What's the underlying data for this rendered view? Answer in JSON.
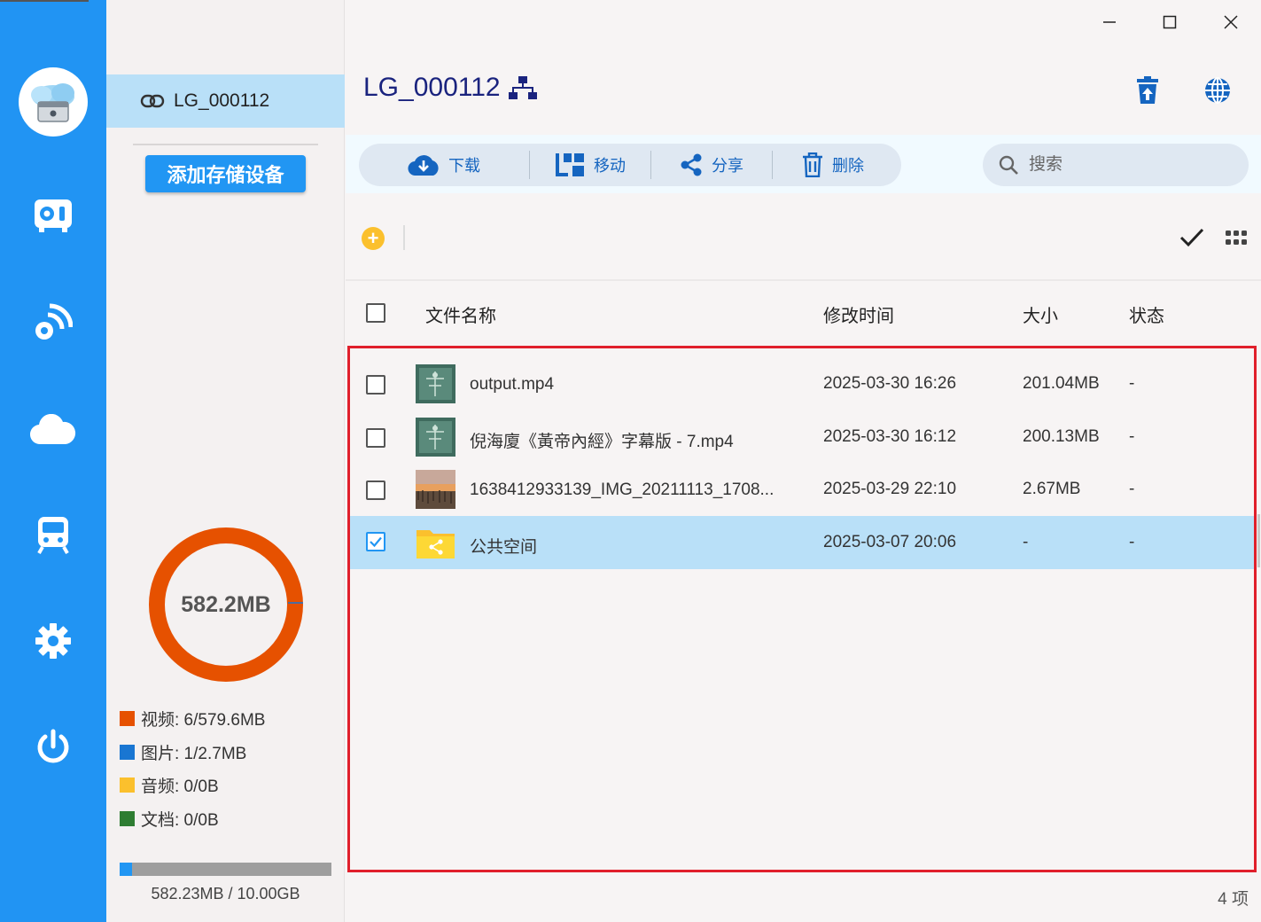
{
  "rail": {
    "icons": [
      "cloud-storage-logo",
      "nas-drive-icon",
      "remote-access-icon",
      "cloud-icon",
      "train-icon",
      "settings-gear-icon",
      "power-icon"
    ]
  },
  "sidebar": {
    "device_label": "LG_000112",
    "add_button": "添加存储设备",
    "donut_label": "582.2MB",
    "legend": [
      {
        "text": "视频: 6/579.6MB",
        "color": "#e65100"
      },
      {
        "text": "图片: 1/2.7MB",
        "color": "#1976d2"
      },
      {
        "text": "音频: 0/0B",
        "color": "#fbc02d"
      },
      {
        "text": "文档: 0/0B",
        "color": "#2e7d32"
      }
    ],
    "usage_fraction": 0.057,
    "usage_text": "582.23MB / 10.00GB"
  },
  "header": {
    "title": "LG_000112",
    "title_icon": "network-icon",
    "actions": [
      "recycle-bin-upload-icon",
      "globe-icon"
    ]
  },
  "toolbar": {
    "download": "下载",
    "move": "移动",
    "share": "分享",
    "delete": "删除"
  },
  "search": {
    "placeholder": "搜索"
  },
  "table": {
    "columns": {
      "name": "文件名称",
      "modified": "修改时间",
      "size": "大小",
      "status": "状态"
    },
    "rows": [
      {
        "name": "output.mp4",
        "modified": "2025-03-30 16:26",
        "size": "201.04MB",
        "status": "-",
        "checked": false,
        "thumb": "video-thumb"
      },
      {
        "name": "倪海廈《黃帝內經》字幕版 - 7.mp4",
        "modified": "2025-03-30 16:12",
        "size": "200.13MB",
        "status": "-",
        "checked": false,
        "thumb": "video-thumb"
      },
      {
        "name": "1638412933139_IMG_20211113_1708...",
        "modified": "2025-03-29 22:10",
        "size": "2.67MB",
        "status": "-",
        "checked": false,
        "thumb": "image-thumb"
      },
      {
        "name": "公共空间",
        "modified": "2025-03-07 20:06",
        "size": "-",
        "status": "-",
        "checked": true,
        "thumb": "shared-folder-icon"
      }
    ]
  },
  "footer": {
    "count": "4 项"
  },
  "colors": {
    "accent": "#2196f3",
    "selection": "#b9e0f8",
    "donut": "#e65100",
    "highlight": "#e01f2b"
  }
}
